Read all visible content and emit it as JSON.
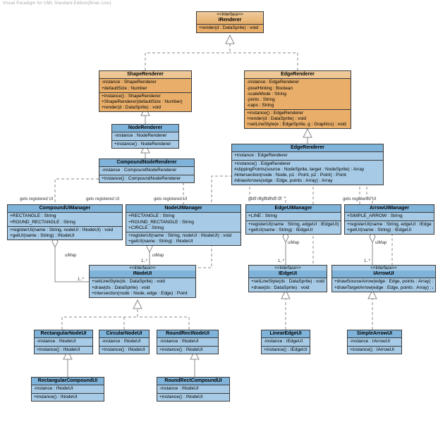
{
  "watermark": "Visual Paradigm for UML Standard Edition(Brian Liou)",
  "stereotype": "<<Interface>>",
  "relLabels": {
    "getsRegisteredUI": "gets registered UI",
    "uiMap": "uiMap",
    "multOneStar": "1..*"
  },
  "classes": {
    "IRenderer": {
      "name": "IRenderer",
      "ops": [
        "+render(d : DataSprite) : void"
      ]
    },
    "ShapeRenderer": {
      "name": "ShapeRenderer",
      "attrs": [
        "-instance : ShapeRenderer",
        "+defaultSize : Number"
      ],
      "ops": [
        "+instance() : ShapeRenderer",
        "+ShapeRenderer(defaultSize : Number)",
        "+render(d : DataSprite) : void"
      ]
    },
    "EdgeRendererTop": {
      "name": "EdgeRenderer",
      "attrs": [
        "-instance : EdgeRenderer",
        "-pixelHinting : Boolean",
        "-scaleMode : String",
        "-joints : String",
        "-caps : String"
      ],
      "ops": [
        "+instance() : EdgeRenderer",
        "+render(d : DataSprite) : void",
        "+setLineStyle(e : EdgeSprite, g : Graphics) : void"
      ]
    },
    "NodeRenderer": {
      "name": "NodeRenderer",
      "attrs": [
        "-instance : NodeRenderer"
      ],
      "ops": [
        "+instance() : NodeRenderer"
      ]
    },
    "CompoundNodeRenderer": {
      "name": "CompoundNodeRenderer",
      "attrs": [
        "-instance : CompoundNodeRenderer"
      ],
      "ops": [
        "+instance() : CompoundNodeRenderer"
      ]
    },
    "EdgeRendererBlue": {
      "name": "EdgeRenderer",
      "attrs": [
        "+instance : EdgeRenderer"
      ],
      "ops": [
        "+instance() : EdgeRenderer",
        "#clippingPoints(source : NodeSprite, target : NodeSprite) : Array",
        "#intersection(node : Node, p1 : Point, p2 : Point) : Point",
        "#drawArrows(edge : Edge, points : Array) : Array"
      ]
    },
    "CompoundUIManager": {
      "name": "CompoundUIManager",
      "attrs": [
        "+RECTANGLE : String",
        "+ROUND_RECTANGLE : String"
      ],
      "ops": [
        "+registerUI(name : String, nodeUI : INodeUI) : void",
        "+getUI(name : String) : INodeUI"
      ]
    },
    "NodeUIManager": {
      "name": "NodeUIManager",
      "attrs": [
        "+RECTANGLE : String",
        "+ROUND_RECTANGLE : String",
        "+CIRCLE : String"
      ],
      "ops": [
        "+registerUI(name : String, nodeUI : INodeUI) : void",
        "+getUI(name : String) : INodeUI"
      ]
    },
    "EdgeUIManager": {
      "name": "EdgeUIManager",
      "attrs": [
        "+LINE : String"
      ],
      "ops": [
        "+registerUI(name : String, edgeUI : IEdgeUI) : void",
        "+getUI(name : String) : IEdgeUI"
      ]
    },
    "ArrowUIManager": {
      "name": "ArrowUIManager",
      "attrs": [
        "+SIMPLE_ARROW : String"
      ],
      "ops": [
        "+registerUI(name : String, edgeUI : IEdgeUI) : void",
        "+getUI(name : String) : IEdgeUI"
      ]
    },
    "INodeUI": {
      "name": "INodeUI",
      "ops": [
        "+setLineStyle(ds : DataSprite) : void",
        "+draw(ds : DataSprite) : void",
        "+intersection(node : Node, edge : Edge) : Point"
      ]
    },
    "IEdgeUI": {
      "name": "IEdgeUI",
      "ops": [
        "+setLineStyle(ds : DataSprite) : void",
        "+draw(ds : DataSprite) : void"
      ]
    },
    "IArrowUI": {
      "name": "IArrowUI",
      "ops": [
        "+drawSourceArrow(edge : Edge, points : Array) : Array",
        "+drawTargetArrow(edge : Edge, points : Array) : Array"
      ]
    },
    "RectangularNodeUI": {
      "name": "RectangularNodeUI",
      "attrs": [
        "-instance : INodeUI"
      ],
      "ops": [
        "+instance() : INodeUI"
      ]
    },
    "CircularNodeUI": {
      "name": "CircularNodeUI",
      "attrs": [
        "-instance : INodeUI"
      ],
      "ops": [
        "+instance() : INodeUI"
      ]
    },
    "RoundRectNodeUI": {
      "name": "RoundRectNodeUI",
      "attrs": [
        "-instance : INodeUI"
      ],
      "ops": [
        "+instance() : INodeUI"
      ]
    },
    "LinearEdgeUI": {
      "name": "LinearEdgeUI",
      "attrs": [
        "-instance : IEdgeUI"
      ],
      "ops": [
        "+instance() : IEdgeUI"
      ]
    },
    "SimpleArrowUI": {
      "name": "SimpleArrowUI",
      "attrs": [
        "-instance : IArrowUI"
      ],
      "ops": [
        "+instance() : IArrowUI"
      ]
    },
    "RectangularCompoundUI": {
      "name": "RectangularCompoundUI",
      "attrs": [
        "-instance : INodeUI"
      ],
      "ops": [
        "+instance() : INodeUI"
      ]
    },
    "RoundRectCompoundUI": {
      "name": "RoundRectCompoundUI",
      "attrs": [
        "-instance : INodeUI"
      ],
      "ops": [
        "+instance() : INodeUI"
      ]
    }
  }
}
